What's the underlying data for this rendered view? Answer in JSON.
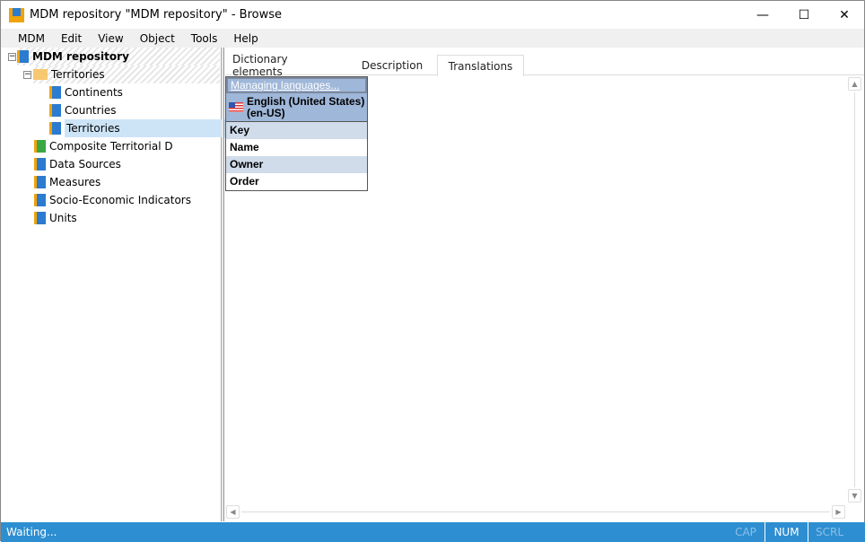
{
  "window": {
    "title": "MDM repository \"MDM repository\" - Browse",
    "minimize": "—",
    "maximize": "☐",
    "close": "✕"
  },
  "menu": [
    "MDM",
    "Edit",
    "View",
    "Object",
    "Tools",
    "Help"
  ],
  "tree": {
    "root": "MDM repository",
    "folder": "Territories",
    "children": [
      "Continents",
      "Countries",
      "Territories"
    ],
    "items": [
      "Composite Territorial D",
      "Data Sources",
      "Measures",
      "Socio-Economic Indicators",
      "Units"
    ]
  },
  "tabs": [
    "Dictionary elements",
    "Description",
    "Translations"
  ],
  "translations": {
    "managing_link": "Managing languages...",
    "language_line1": "English (United States)",
    "language_line2": "(en-US)",
    "rows": [
      "Key",
      "Name",
      "Owner",
      "Order"
    ]
  },
  "status": {
    "text": "Waiting...",
    "cap": "CAP",
    "num": "NUM",
    "scrl": "SCRL"
  }
}
